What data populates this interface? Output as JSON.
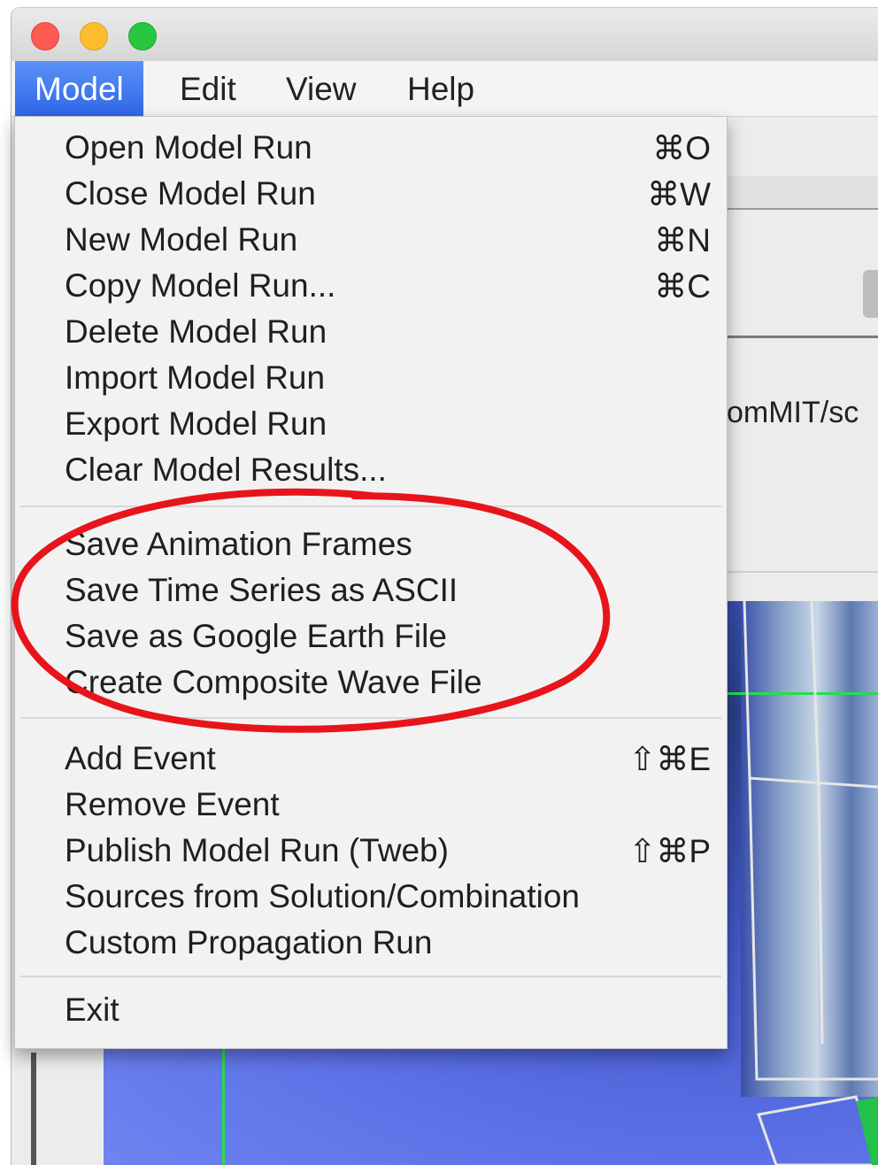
{
  "window": {
    "traffic_lights": [
      "close",
      "minimize",
      "zoom"
    ]
  },
  "menubar": {
    "items": [
      "Model",
      "Edit",
      "View",
      "Help"
    ],
    "active": "Model"
  },
  "background": {
    "path_fragment": "omMIT/sc"
  },
  "dropdown": {
    "group1": [
      {
        "label": "Open Model Run",
        "shortcut": "⌘O"
      },
      {
        "label": "Close Model Run",
        "shortcut": "⌘W"
      },
      {
        "label": "New Model Run",
        "shortcut": "⌘N"
      },
      {
        "label": "Copy Model Run...",
        "shortcut": "⌘C"
      },
      {
        "label": "Delete Model Run",
        "shortcut": ""
      },
      {
        "label": "Import Model Run",
        "shortcut": ""
      },
      {
        "label": "Export Model Run",
        "shortcut": ""
      },
      {
        "label": "Clear Model Results...",
        "shortcut": ""
      }
    ],
    "group2": [
      {
        "label": "Save Animation Frames",
        "shortcut": ""
      },
      {
        "label": "Save Time Series as ASCII",
        "shortcut": ""
      },
      {
        "label": "Save as Google Earth File",
        "shortcut": ""
      },
      {
        "label": "Create Composite Wave File",
        "shortcut": ""
      }
    ],
    "group3": [
      {
        "label": "Add Event",
        "shortcut": "⇧⌘E"
      },
      {
        "label": "Remove Event",
        "shortcut": ""
      },
      {
        "label": "Publish Model Run (Tweb)",
        "shortcut": "⇧⌘P"
      },
      {
        "label": "Sources from Solution/Combination",
        "shortcut": ""
      },
      {
        "label": "Custom Propagation Run",
        "shortcut": ""
      }
    ],
    "group4": [
      {
        "label": "Exit",
        "shortcut": ""
      }
    ]
  },
  "colors": {
    "highlight": "#2f67e8",
    "annotation": "#e8141b",
    "map_grid": "#22e04a"
  }
}
